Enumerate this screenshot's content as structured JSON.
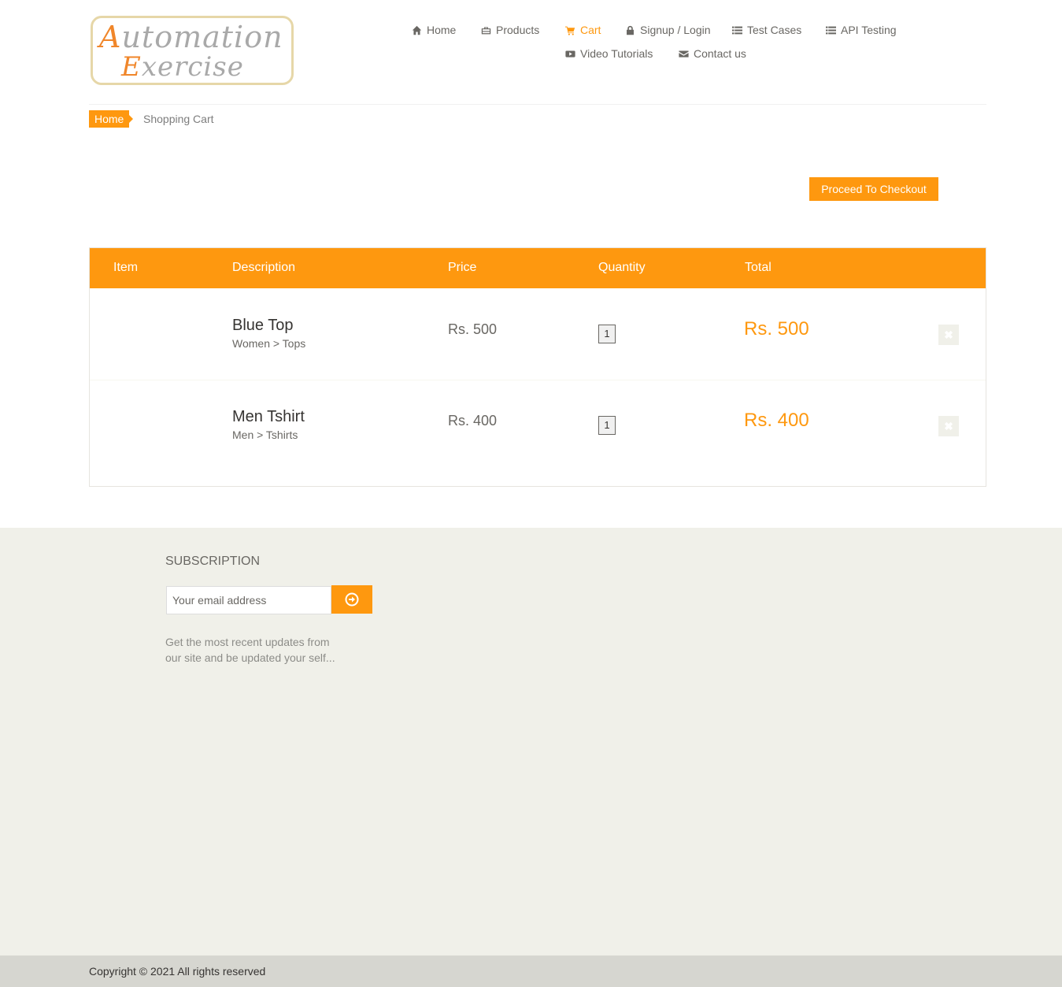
{
  "logo": {
    "line1_cap": "A",
    "line1_rest": "utomation",
    "line2_cap": "E",
    "line2_rest": "xercise"
  },
  "nav": {
    "home": "Home",
    "products": "Products",
    "cart": "Cart",
    "login": "Signup / Login",
    "test_cases": "Test Cases",
    "api_testing": "API Testing",
    "video_tutorials": "Video Tutorials",
    "contact": "Contact us"
  },
  "breadcrumb": {
    "home": "Home",
    "current": "Shopping Cart"
  },
  "checkout_label": "Proceed To Checkout",
  "cart_table": {
    "headers": [
      "Item",
      "Description",
      "Price",
      "Quantity",
      "Total"
    ],
    "rows": [
      {
        "name": "Blue Top",
        "category": "Women > Tops",
        "price": "Rs. 500",
        "quantity": "1",
        "total": "Rs. 500"
      },
      {
        "name": "Men Tshirt",
        "category": "Men > Tshirts",
        "price": "Rs. 400",
        "quantity": "1",
        "total": "Rs. 400"
      }
    ]
  },
  "subscription": {
    "title": "SUBSCRIPTION",
    "placeholder": "Your email address",
    "text": "Get the most recent updates from our site and be updated your self..."
  },
  "footer": {
    "copyright": "Copyright © 2021 All rights reserved"
  },
  "colors": {
    "accent": "#fe980f",
    "text": "#696763",
    "footer_bg": "#f0f0e9",
    "bottom_bar": "#d6d6d0"
  },
  "icons": {
    "home": "home-icon",
    "products": "briefcase-icon",
    "cart": "shopping-cart-icon",
    "login": "lock-icon",
    "test_cases": "list-icon",
    "api_testing": "list-icon",
    "video": "youtube-play-icon",
    "contact": "envelope-icon",
    "delete": "close-icon",
    "subscribe": "arrow-circle-right-icon"
  }
}
